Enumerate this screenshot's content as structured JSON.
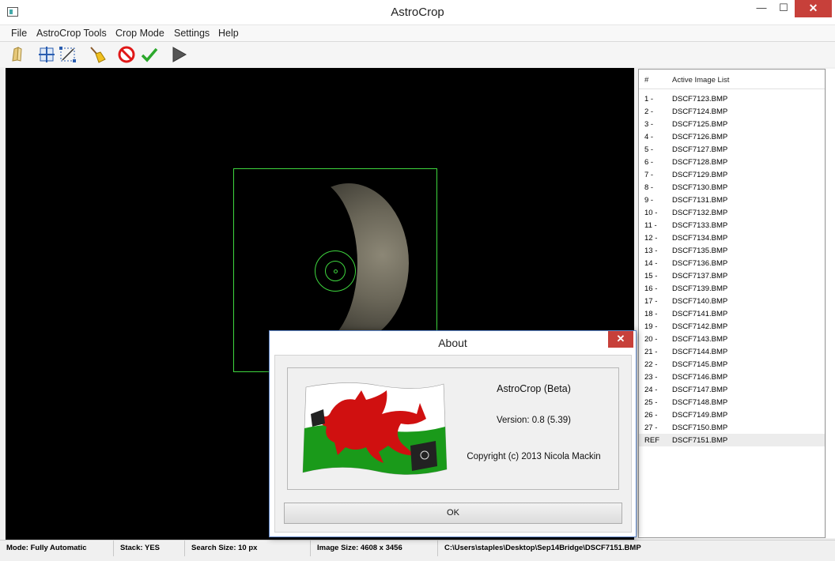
{
  "window": {
    "title": "AstroCrop",
    "minimize_label": "—",
    "maximize_label": "☐",
    "close_label": "✕"
  },
  "menu": {
    "items": [
      "File",
      "AstroCrop Tools",
      "Crop Mode",
      "Settings",
      "Help"
    ]
  },
  "toolbar": {
    "icons": [
      "open-folder-icon",
      "align-grid-icon",
      "crop-select-icon",
      "broom-icon",
      "cancel-icon",
      "check-icon",
      "play-icon"
    ]
  },
  "image_list": {
    "header_num": "#",
    "header_name": "Active Image List",
    "rows": [
      {
        "num": "1 -",
        "file": "DSCF7123.BMP"
      },
      {
        "num": "2 -",
        "file": "DSCF7124.BMP"
      },
      {
        "num": "3 -",
        "file": "DSCF7125.BMP"
      },
      {
        "num": "4 -",
        "file": "DSCF7126.BMP"
      },
      {
        "num": "5 -",
        "file": "DSCF7127.BMP"
      },
      {
        "num": "6 -",
        "file": "DSCF7128.BMP"
      },
      {
        "num": "7 -",
        "file": "DSCF7129.BMP"
      },
      {
        "num": "8 -",
        "file": "DSCF7130.BMP"
      },
      {
        "num": "9 -",
        "file": "DSCF7131.BMP"
      },
      {
        "num": "10 -",
        "file": "DSCF7132.BMP"
      },
      {
        "num": "11 -",
        "file": "DSCF7133.BMP"
      },
      {
        "num": "12 -",
        "file": "DSCF7134.BMP"
      },
      {
        "num": "13 -",
        "file": "DSCF7135.BMP"
      },
      {
        "num": "14 -",
        "file": "DSCF7136.BMP"
      },
      {
        "num": "15 -",
        "file": "DSCF7137.BMP"
      },
      {
        "num": "16 -",
        "file": "DSCF7139.BMP"
      },
      {
        "num": "17 -",
        "file": "DSCF7140.BMP"
      },
      {
        "num": "18 -",
        "file": "DSCF7141.BMP"
      },
      {
        "num": "19 -",
        "file": "DSCF7142.BMP"
      },
      {
        "num": "20 -",
        "file": "DSCF7143.BMP"
      },
      {
        "num": "21 -",
        "file": "DSCF7144.BMP"
      },
      {
        "num": "22 -",
        "file": "DSCF7145.BMP"
      },
      {
        "num": "23 -",
        "file": "DSCF7146.BMP"
      },
      {
        "num": "24 -",
        "file": "DSCF7147.BMP"
      },
      {
        "num": "25 -",
        "file": "DSCF7148.BMP"
      },
      {
        "num": "26 -",
        "file": "DSCF7149.BMP"
      },
      {
        "num": "27 -",
        "file": "DSCF7150.BMP"
      },
      {
        "num": "REF",
        "file": "DSCF7151.BMP"
      }
    ]
  },
  "status": {
    "mode": "Mode: Fully Automatic",
    "stack": "Stack: YES",
    "search": "Search Size: 10 px",
    "image_size": "Image Size: 4608 x 3456",
    "path": "C:\\Users\\staples\\Desktop\\Sep14Bridge\\DSCF7151.BMP"
  },
  "about": {
    "title": "About",
    "close_label": "✕",
    "app_name": "AstroCrop (Beta)",
    "version": "Version: 0.8 (5.39)",
    "copyright": "Copyright (c) 2013 Nicola Mackin",
    "ok_label": "OK"
  },
  "colors": {
    "crop_overlay": "#3ed63e",
    "close_button": "#c7403a",
    "flag_red": "#d01010",
    "flag_green": "#1a9a1a"
  }
}
